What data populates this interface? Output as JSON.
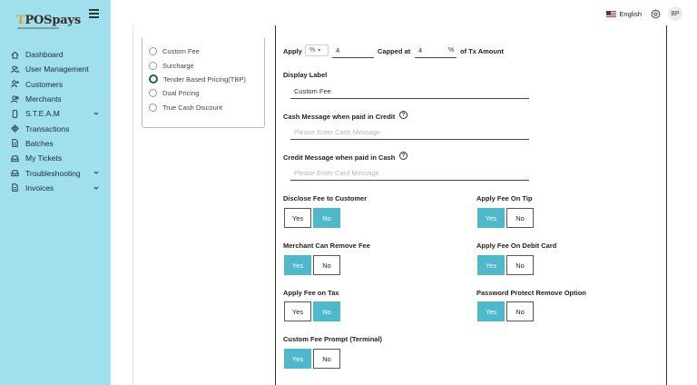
{
  "brand": {
    "logo_text": "POSpays"
  },
  "sidebar": {
    "items": [
      {
        "label": "Dashboard",
        "icon": "home-icon",
        "has_chevron": false
      },
      {
        "label": "User Management",
        "icon": "users-icon",
        "has_chevron": false
      },
      {
        "label": "Customers",
        "icon": "user-add-icon",
        "has_chevron": false
      },
      {
        "label": "Merchants",
        "icon": "merchants-icon",
        "has_chevron": false
      },
      {
        "label": "S.T.E.A.M",
        "icon": "device-icon",
        "has_chevron": true
      },
      {
        "label": "Transactions",
        "icon": "dollar-icon",
        "has_chevron": false
      },
      {
        "label": "Batches",
        "icon": "document-icon",
        "has_chevron": false
      },
      {
        "label": "My Tickets",
        "icon": "inbox-icon",
        "has_chevron": false
      },
      {
        "label": "Troubleshooting",
        "icon": "inbox-icon",
        "has_chevron": true
      },
      {
        "label": "Invoices",
        "icon": "document-icon",
        "has_chevron": true
      }
    ]
  },
  "topbar": {
    "language": "English",
    "avatar_initials": "BP"
  },
  "fee_types": [
    {
      "label": "Custom Fee",
      "selected": false
    },
    {
      "label": "Surcharge",
      "selected": false
    },
    {
      "label": "Tender Based Pricing(TBP)",
      "selected": true
    },
    {
      "label": "Dual Pricing",
      "selected": false
    },
    {
      "label": "True Cash Discount",
      "selected": false
    }
  ],
  "form": {
    "apply_label": "Apply",
    "apply_unit": "%",
    "apply_value": "4",
    "capped_label": "Capped at",
    "capped_value": "4",
    "capped_unit": "%",
    "capped_suffix": "of Tx Amount",
    "display_label_title": "Display Label",
    "display_label_value": "Custom Fee",
    "cash_msg_title": "Cash Message when paid in Credit",
    "cash_msg_placeholder": "Please Enter Cash Message",
    "credit_msg_title": "Credit Message when paid in Cash",
    "credit_msg_placeholder": "Please Enter Card Message",
    "toggles": [
      {
        "key": "disclose",
        "label": "Disclose Fee to Customer",
        "yes": "Yes",
        "no": "No",
        "selected": "no"
      },
      {
        "key": "tip",
        "label": "Apply Fee On Tip",
        "yes": "Yes",
        "no": "No",
        "selected": "yes"
      },
      {
        "key": "merchant_remove",
        "label": "Merchant Can Remove Fee",
        "yes": "Yes",
        "no": "No",
        "selected": "yes"
      },
      {
        "key": "debit",
        "label": "Apply Fee On Debit Card",
        "yes": "Yes",
        "no": "No",
        "selected": "yes"
      },
      {
        "key": "tax",
        "label": "Apply Fee on Tax",
        "yes": "Yes",
        "no": "No",
        "selected": "no"
      },
      {
        "key": "password",
        "label": "Password Protect Remove Option",
        "yes": "Yes",
        "no": "No",
        "selected": "yes"
      },
      {
        "key": "prompt",
        "label": "Custom Fee Prompt (Terminal)",
        "yes": "Yes",
        "no": "No",
        "selected": "yes"
      }
    ]
  },
  "colors": {
    "sidebar_bg": "#9fe0ec",
    "accent": "#4fb9cc",
    "radio_selected": "#1f5e6c"
  }
}
